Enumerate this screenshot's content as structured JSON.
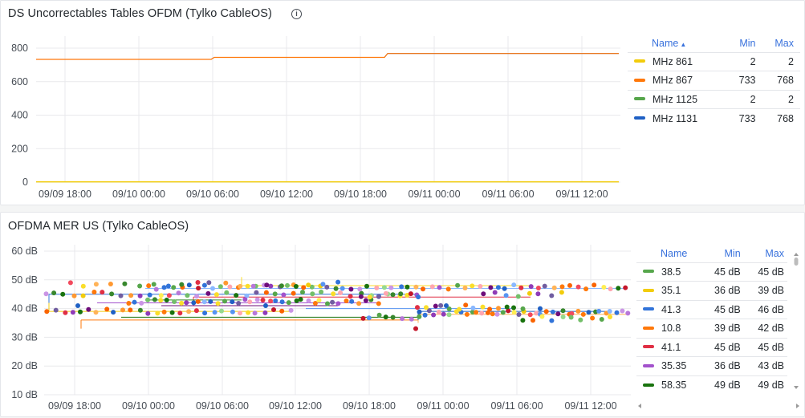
{
  "panel1": {
    "title": "DS Uncorrectables Tables OFDM (Tylko CableOS)",
    "info_icon": "info-circle-icon",
    "y_ticks": [
      "800",
      "600",
      "400",
      "200",
      "0"
    ],
    "x_ticks": [
      "09/09 18:00",
      "09/10 00:00",
      "09/10 06:00",
      "09/10 12:00",
      "09/10 18:00",
      "09/11 00:00",
      "09/11 06:00",
      "09/11 12:00"
    ],
    "legend_headers": {
      "name": "Name",
      "sort_icon": "sort-ascending-icon",
      "min": "Min",
      "max": "Max"
    },
    "legend": [
      {
        "name": "MHz 861",
        "min": "2",
        "max": "2",
        "color": "#f2cc0c"
      },
      {
        "name": "MHz 867",
        "min": "733",
        "max": "768",
        "color": "#ff780a"
      },
      {
        "name": "MHz 1125",
        "min": "2",
        "max": "2",
        "color": "#56a64b"
      },
      {
        "name": "MHz 1131",
        "min": "733",
        "max": "768",
        "color": "#1f60c4"
      }
    ]
  },
  "panel2": {
    "title": "OFDMA MER US (Tylko CableOS)",
    "y_ticks": [
      "60 dB",
      "50 dB",
      "40 dB",
      "30 dB",
      "20 dB",
      "10 dB"
    ],
    "x_ticks": [
      "09/09 18:00",
      "09/10 00:00",
      "09/10 06:00",
      "09/10 12:00",
      "09/10 18:00",
      "09/11 00:00",
      "09/11 06:00",
      "09/11 12:00"
    ],
    "legend_headers": {
      "name": "Name",
      "min": "Min",
      "max": "Max"
    },
    "legend": [
      {
        "name": "38.5",
        "min": "45 dB",
        "max": "45 dB",
        "color": "#56a64b"
      },
      {
        "name": "35.1",
        "min": "36 dB",
        "max": "39 dB",
        "color": "#f2cc0c"
      },
      {
        "name": "41.3",
        "min": "45 dB",
        "max": "46 dB",
        "color": "#3274d9"
      },
      {
        "name": "10.8",
        "min": "39 dB",
        "max": "42 dB",
        "color": "#ff780a"
      },
      {
        "name": "41.1",
        "min": "45 dB",
        "max": "45 dB",
        "color": "#e02f44"
      },
      {
        "name": "35.35",
        "min": "36 dB",
        "max": "43 dB",
        "color": "#a352cc"
      },
      {
        "name": "58.35",
        "min": "49 dB",
        "max": "49 dB",
        "color": "#19730e"
      }
    ]
  },
  "chart_data": [
    {
      "type": "line",
      "title": "DS Uncorrectables Tables OFDM (Tylko CableOS)",
      "x": [
        "09/09 18:00",
        "09/10 00:00",
        "09/10 06:00",
        "09/10 12:00",
        "09/10 18:00",
        "09/11 00:00",
        "09/11 06:00",
        "09/11 12:00"
      ],
      "ylim": [
        0,
        800
      ],
      "series": [
        {
          "name": "MHz 861",
          "values": [
            2,
            2,
            2,
            2,
            2,
            2,
            2,
            2
          ]
        },
        {
          "name": "MHz 867",
          "values": [
            733,
            733,
            745,
            745,
            745,
            768,
            768,
            768
          ]
        },
        {
          "name": "MHz 1125",
          "values": [
            2,
            2,
            2,
            2,
            2,
            2,
            2,
            2
          ]
        },
        {
          "name": "MHz 1131",
          "values": [
            733,
            733,
            745,
            745,
            745,
            768,
            768,
            768
          ]
        }
      ],
      "grid": true,
      "legend": "right"
    },
    {
      "type": "scatter",
      "title": "OFDMA MER US (Tylko CableOS)",
      "x": [
        "09/09 18:00",
        "09/10 00:00",
        "09/10 06:00",
        "09/10 12:00",
        "09/10 18:00",
        "09/11 00:00",
        "09/11 06:00",
        "09/11 12:00"
      ],
      "ylim": [
        10,
        60
      ],
      "series": [
        {
          "name": "38.5",
          "values": [
            45,
            45,
            45,
            45,
            45,
            45,
            45,
            45
          ]
        },
        {
          "name": "35.1",
          "values": [
            38,
            39,
            38,
            37,
            37,
            36,
            38,
            38
          ]
        },
        {
          "name": "41.3",
          "values": [
            45,
            45,
            46,
            45,
            45,
            45,
            46,
            46
          ]
        },
        {
          "name": "10.8",
          "values": [
            39,
            40,
            41,
            42,
            41,
            40,
            40,
            41
          ]
        },
        {
          "name": "41.1",
          "values": [
            45,
            45,
            45,
            45,
            45,
            45,
            45,
            45
          ]
        },
        {
          "name": "35.35",
          "values": [
            43,
            42,
            40,
            38,
            36,
            37,
            39,
            41
          ]
        },
        {
          "name": "58.35",
          "values": [
            49,
            49,
            49,
            49,
            49,
            49,
            49,
            49
          ]
        }
      ],
      "grid": true,
      "legend": "right"
    }
  ]
}
